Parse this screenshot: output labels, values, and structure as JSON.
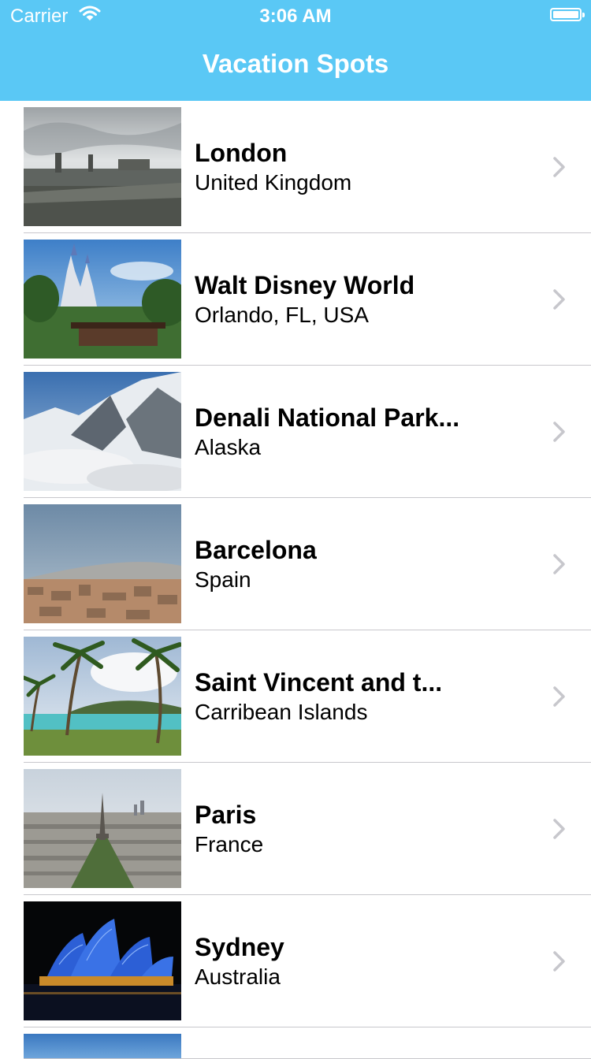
{
  "status_bar": {
    "carrier": "Carrier",
    "time": "3:06 AM",
    "wifi_icon": "wifi-icon",
    "battery_icon": "battery-icon"
  },
  "nav": {
    "title": "Vacation Spots",
    "background_color": "#5ac8f5"
  },
  "list": {
    "items": [
      {
        "name": "London",
        "location": "United Kingdom",
        "thumbnail": "london-photo",
        "accessory_icon": "chevron-right-icon"
      },
      {
        "name": "Walt Disney World",
        "location": "Orlando, FL, USA",
        "thumbnail": "castle-photo",
        "accessory_icon": "chevron-right-icon"
      },
      {
        "name": "Denali National Park...",
        "location": "Alaska",
        "thumbnail": "mountain-photo",
        "accessory_icon": "chevron-right-icon"
      },
      {
        "name": "Barcelona",
        "location": "Spain",
        "thumbnail": "city-photo",
        "accessory_icon": "chevron-right-icon"
      },
      {
        "name": "Saint Vincent and t...",
        "location": "Carribean Islands",
        "thumbnail": "beach-photo",
        "accessory_icon": "chevron-right-icon"
      },
      {
        "name": "Paris",
        "location": "France",
        "thumbnail": "paris-photo",
        "accessory_icon": "chevron-right-icon"
      },
      {
        "name": "Sydney",
        "location": "Australia",
        "thumbnail": "opera-house-photo",
        "accessory_icon": "chevron-right-icon"
      }
    ]
  }
}
